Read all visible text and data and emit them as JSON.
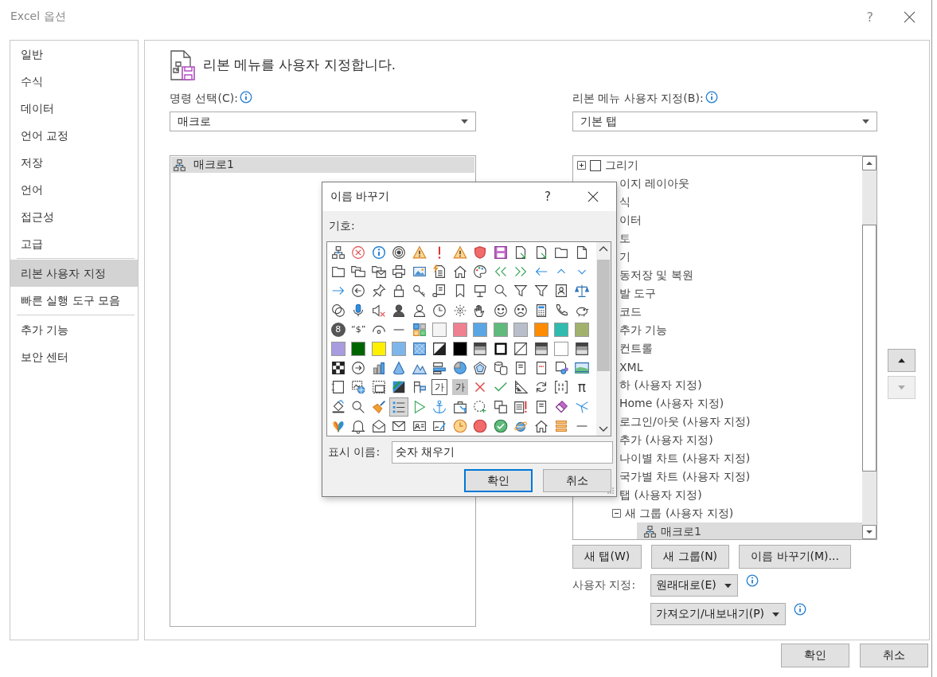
{
  "window": {
    "title": "Excel 옵션",
    "help": "?"
  },
  "sidebar": {
    "groups": [
      [
        {
          "label": "일반",
          "selected": false
        },
        {
          "label": "수식",
          "selected": false
        },
        {
          "label": "데이터",
          "selected": false
        },
        {
          "label": "언어 교정",
          "selected": false
        },
        {
          "label": "저장",
          "selected": false
        },
        {
          "label": "언어",
          "selected": false
        },
        {
          "label": "접근성",
          "selected": false
        },
        {
          "label": "고급",
          "selected": false
        }
      ],
      [
        {
          "label": "리본 사용자 지정",
          "selected": true
        },
        {
          "label": "빠른 실행 도구 모음",
          "selected": false
        }
      ],
      [
        {
          "label": "추가 기능",
          "selected": false
        },
        {
          "label": "보안 센터",
          "selected": false
        }
      ]
    ]
  },
  "header": {
    "title": "리본 메뉴를 사용자 지정합니다."
  },
  "commands": {
    "label": "명령 선택(C):",
    "dropdown": "매크로",
    "items": [
      {
        "label": "매크로1",
        "selected": true
      }
    ]
  },
  "ribbon": {
    "label": "리본 메뉴 사용자 지정(B):",
    "dropdown": "기본 탭",
    "tree": [
      {
        "label": "그리기",
        "selected": false,
        "expanded": false,
        "checked": false
      },
      {
        "label": "이지 레이아웃",
        "selected": false
      },
      {
        "label": "식",
        "selected": false
      },
      {
        "label": "이터",
        "selected": false
      },
      {
        "label": "토",
        "selected": false
      },
      {
        "label": "기",
        "selected": false
      },
      {
        "label": "동저장 및 복원",
        "selected": false
      },
      {
        "label": "발 도구",
        "selected": false,
        "children": [
          {
            "label": "코드",
            "selected": false
          },
          {
            "label": "추가 기능",
            "selected": false
          },
          {
            "label": "컨트롤",
            "selected": false
          },
          {
            "label": "XML",
            "selected": false
          }
        ]
      },
      {
        "label": "하 (사용자 지정)",
        "selected": false,
        "children": [
          {
            "label": "Home (사용자 지정)",
            "selected": false
          },
          {
            "label": "로그인/아웃 (사용자 지정)",
            "selected": false
          },
          {
            "label": "추가 (사용자 지정)",
            "selected": false
          },
          {
            "label": "나이별 차트 (사용자 지정)",
            "selected": false
          },
          {
            "label": "국가별 차트 (사용자 지정)",
            "selected": false
          }
        ]
      },
      {
        "label": "탭 (사용자 지정)",
        "selected": false,
        "children": [
          {
            "label": "새 그룹 (사용자 지정)",
            "selected": false,
            "expanded": true,
            "children": [
              {
                "label": "매크로1",
                "selected": true,
                "kind": "macro"
              }
            ]
          }
        ]
      }
    ],
    "buttons": [
      "새 탭(W)",
      "새 그룹(N)",
      "이름 바꾸기(M)..."
    ],
    "customize_label": "사용자 지정:",
    "reset": "원래대로(E)",
    "import_export": "가져오기/내보내기(P)"
  },
  "move_buttons": [
    {
      "kind": "up",
      "disabled": false
    },
    {
      "kind": "down",
      "disabled": true
    }
  ],
  "footer_buttons": [
    "확인",
    "취소"
  ],
  "rename_dialog": {
    "title": "이름 바꾸기",
    "help": "?",
    "symbols_label": "기호:",
    "symbols": [
      {
        "kind": "hierarchy",
        "selected": false
      },
      {
        "kind": "x-circle",
        "selected": false
      },
      {
        "kind": "info-circle",
        "selected": false
      },
      {
        "kind": "target",
        "selected": false
      },
      {
        "kind": "warning",
        "selected": false
      },
      {
        "kind": "exclamation",
        "selected": false
      },
      {
        "kind": "warning",
        "selected": false
      },
      {
        "kind": "shield",
        "selected": false
      },
      {
        "kind": "floppy",
        "selected": false
      },
      {
        "kind": "document-arrow",
        "selected": false
      },
      {
        "kind": "document-arrow",
        "selected": false
      },
      {
        "kind": "folder",
        "selected": false
      },
      {
        "kind": "page",
        "selected": false
      },
      {
        "kind": "folder",
        "selected": false
      },
      {
        "kind": "folders",
        "selected": false
      },
      {
        "kind": "folder-mail",
        "selected": false
      },
      {
        "kind": "printer",
        "selected": false
      },
      {
        "kind": "picture",
        "selected": false
      },
      {
        "kind": "document-bolt",
        "selected": false
      },
      {
        "kind": "house",
        "selected": false
      },
      {
        "kind": "palette",
        "selected": false
      },
      {
        "kind": "double-left-arrow",
        "selected": false
      },
      {
        "kind": "double-right-arrow",
        "selected": false
      },
      {
        "kind": "left-arrow",
        "selected": false
      },
      {
        "kind": "up-chevron",
        "selected": false
      },
      {
        "kind": "down-chevron",
        "selected": false
      },
      {
        "kind": "right-arrow",
        "selected": false
      },
      {
        "kind": "circle-left-arrow",
        "selected": false
      },
      {
        "kind": "pushpin",
        "selected": false
      },
      {
        "kind": "padlock",
        "selected": false
      },
      {
        "kind": "key",
        "selected": false
      },
      {
        "kind": "scroll",
        "selected": false
      },
      {
        "kind": "bookmark",
        "selected": false
      },
      {
        "kind": "easel",
        "selected": false
      },
      {
        "kind": "magnifier",
        "selected": false
      },
      {
        "kind": "funnel",
        "selected": false
      },
      {
        "kind": "funnel",
        "selected": false
      },
      {
        "kind": "contact-card",
        "selected": false
      },
      {
        "kind": "scales",
        "selected": false
      },
      {
        "kind": "overlapping-circles",
        "selected": false
      },
      {
        "kind": "microphone",
        "selected": false
      },
      {
        "kind": "muted-speaker",
        "selected": false
      },
      {
        "kind": "person",
        "selected": false
      },
      {
        "kind": "person-outline",
        "selected": false
      },
      {
        "kind": "clock",
        "selected": false
      },
      {
        "kind": "sparkle",
        "selected": false
      },
      {
        "kind": "hand",
        "selected": false
      },
      {
        "kind": "smiley",
        "selected": false
      },
      {
        "kind": "sad-face",
        "selected": false
      },
      {
        "kind": "calculator",
        "selected": false
      },
      {
        "kind": "phone",
        "selected": false
      },
      {
        "kind": "piggy-bank",
        "selected": false
      },
      {
        "kind": "number-badge",
        "text": "8",
        "selected": false
      },
      {
        "kind": "dollar-sign",
        "text": "“$”",
        "selected": false
      },
      {
        "kind": "eye",
        "selected": false
      },
      {
        "kind": "dash",
        "selected": false
      },
      {
        "kind": "tiles",
        "selected": false
      },
      {
        "kind": "swatch",
        "color": "#f4f4f4",
        "selected": false
      },
      {
        "kind": "swatch",
        "color": "#ef8090",
        "selected": false
      },
      {
        "kind": "swatch",
        "color": "#5aa6e4",
        "selected": false
      },
      {
        "kind": "swatch",
        "color": "#5fbb7c",
        "selected": false
      },
      {
        "kind": "swatch",
        "color": "#b8bfca",
        "selected": false
      },
      {
        "kind": "swatch",
        "color": "#ff8c00",
        "selected": false
      },
      {
        "kind": "swatch",
        "color": "#2fbcaf",
        "selected": false
      },
      {
        "kind": "swatch",
        "color": "#a2b26c",
        "selected": false
      },
      {
        "kind": "swatch",
        "color": "#a99be0",
        "selected": false
      },
      {
        "kind": "swatch",
        "color": "#006400",
        "selected": false
      },
      {
        "kind": "swatch",
        "color": "#ffef00",
        "selected": false
      },
      {
        "kind": "swatch",
        "color": "#7fb6ea",
        "selected": false
      },
      {
        "kind": "crosshatch",
        "selected": false
      },
      {
        "kind": "diagonal-split",
        "selected": false
      },
      {
        "kind": "swatch",
        "color": "#000000",
        "selected": false
      },
      {
        "kind": "gradient",
        "selected": false
      },
      {
        "kind": "thick-frame",
        "selected": false
      },
      {
        "kind": "diagonal-line",
        "selected": false
      },
      {
        "kind": "gradient",
        "selected": false
      },
      {
        "kind": "swatch",
        "color": "#ffffff",
        "selected": false
      },
      {
        "kind": "gradient",
        "selected": false
      },
      {
        "kind": "checker",
        "selected": false
      },
      {
        "kind": "circle-right-arrow",
        "selected": false
      },
      {
        "kind": "bar-chart",
        "selected": false
      },
      {
        "kind": "cone",
        "selected": false
      },
      {
        "kind": "mountains",
        "selected": false
      },
      {
        "kind": "horizontal-bars",
        "selected": false
      },
      {
        "kind": "pie-chart",
        "selected": false
      },
      {
        "kind": "radar-chart",
        "selected": false
      },
      {
        "kind": "cylinders",
        "selected": false
      },
      {
        "kind": "notebook",
        "selected": false
      },
      {
        "kind": "dotted-book",
        "selected": false
      },
      {
        "kind": "document-gears",
        "selected": false
      },
      {
        "kind": "landscape",
        "selected": false
      },
      {
        "kind": "dashed-page",
        "selected": false
      },
      {
        "kind": "picture-globe",
        "selected": false
      },
      {
        "kind": "dashed-frame",
        "selected": false
      },
      {
        "kind": "striped-triangle",
        "selected": false
      },
      {
        "kind": "flags",
        "selected": false
      },
      {
        "kind": "letter-tile",
        "text": "가",
        "selected": false
      },
      {
        "kind": "shaded-letter-tile",
        "text": "가",
        "selected": false
      },
      {
        "kind": "cross",
        "selected": false
      },
      {
        "kind": "check",
        "selected": false
      },
      {
        "kind": "set-square",
        "selected": false
      },
      {
        "kind": "refresh",
        "selected": false
      },
      {
        "kind": "brackets",
        "selected": false
      },
      {
        "kind": "pi-symbol",
        "text": "π",
        "selected": false
      },
      {
        "kind": "paint-bucket",
        "selected": false
      },
      {
        "kind": "magnifier",
        "selected": false
      },
      {
        "kind": "broom",
        "selected": false
      },
      {
        "kind": "bullet-list",
        "selected": true
      },
      {
        "kind": "play",
        "selected": false
      },
      {
        "kind": "anchor",
        "selected": false
      },
      {
        "kind": "toolbox",
        "selected": false
      },
      {
        "kind": "dashed-circle-plus",
        "selected": false
      },
      {
        "kind": "copy",
        "selected": false
      },
      {
        "kind": "document-alert",
        "selected": false
      },
      {
        "kind": "notebook",
        "selected": false
      },
      {
        "kind": "eraser",
        "selected": false
      },
      {
        "kind": "fork-lines",
        "selected": false
      },
      {
        "kind": "butterfly",
        "selected": false
      },
      {
        "kind": "bell",
        "selected": false
      },
      {
        "kind": "open-envelope",
        "selected": false
      },
      {
        "kind": "envelope",
        "selected": false
      },
      {
        "kind": "id-card",
        "selected": false
      },
      {
        "kind": "signature",
        "selected": false
      },
      {
        "kind": "alarm-clock",
        "selected": false
      },
      {
        "kind": "disc",
        "selected": false
      },
      {
        "kind": "check-circle",
        "selected": false
      },
      {
        "kind": "globe",
        "selected": false
      },
      {
        "kind": "house",
        "selected": false
      },
      {
        "kind": "stack",
        "selected": false
      },
      {
        "kind": "dash",
        "selected": false
      }
    ],
    "display_name_label": "표시 이름:",
    "display_name": "숫자 채우기",
    "buttons": [
      "확인",
      "취소"
    ]
  }
}
